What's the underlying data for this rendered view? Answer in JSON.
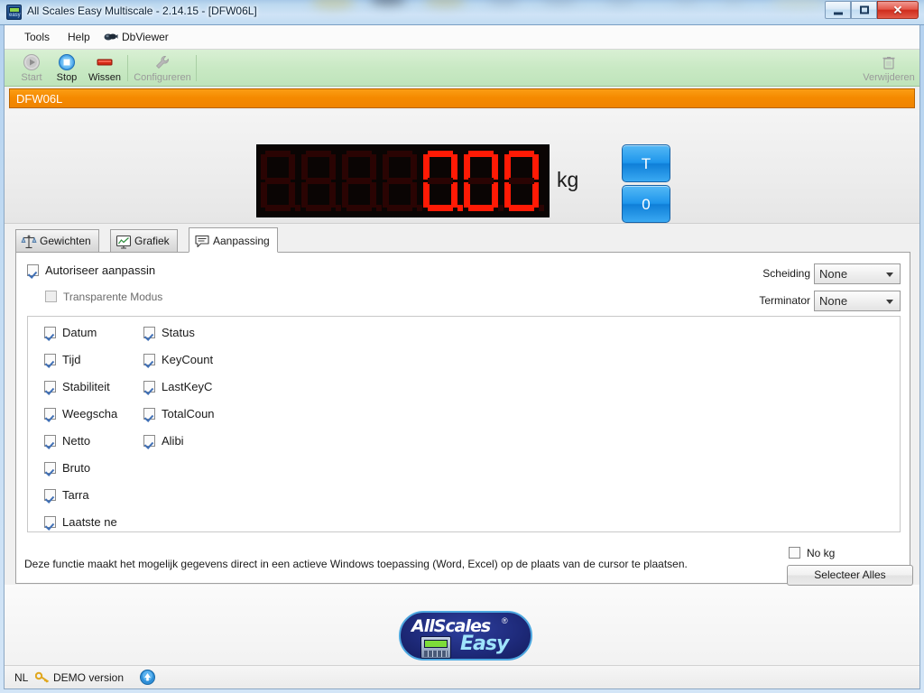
{
  "window": {
    "title": "All Scales Easy Multiscale - 2.14.15 - [DFW06L]",
    "app_icon": "allscales-easy-icon",
    "controls": {
      "minimize": "—",
      "maximize": "□",
      "close": "✕"
    }
  },
  "menubar": {
    "items": [
      {
        "label": "Tools",
        "icon": null
      },
      {
        "label": "Help",
        "icon": null
      },
      {
        "label": "DbViewer",
        "icon": "database-viewer-icon"
      }
    ]
  },
  "toolbar": {
    "buttons": [
      {
        "label": "Start",
        "icon": "play-icon",
        "enabled": false
      },
      {
        "label": "Stop",
        "icon": "stop-square-icon",
        "enabled": true
      },
      {
        "label": "Wissen",
        "icon": "eraser-icon",
        "enabled": true
      },
      {
        "label": "Configureren",
        "icon": "wrench-icon",
        "enabled": false
      }
    ],
    "delete_button": {
      "label": "Verwijderen",
      "icon": "trash-icon",
      "enabled": false
    }
  },
  "scale_header": {
    "name": "DFW06L",
    "background_color": "#f58a00",
    "text_color": "#ffffff"
  },
  "display": {
    "placeholder_digits": "8888888",
    "value": "0.00",
    "lit_color": "#ff1a05",
    "dim_color": "#2a0403",
    "background_color": "#0a0504",
    "unit": "kg",
    "buttons": [
      {
        "label": "T",
        "name": "tare-button"
      },
      {
        "label": "0",
        "name": "zero-button"
      }
    ]
  },
  "tabs": [
    {
      "label": "Gewichten",
      "icon": "balance-scale-icon",
      "active": false
    },
    {
      "label": "Grafiek",
      "icon": "line-chart-icon",
      "active": false
    },
    {
      "label": "Aanpassing",
      "icon": "speech-bubble-icon",
      "active": true
    }
  ],
  "panel": {
    "authorize": {
      "label": "Autoriseer aanpassin",
      "checked": true
    },
    "transparent_mode": {
      "label": "Transparente Modus",
      "checked": false,
      "enabled": false
    },
    "dropdowns": [
      {
        "label": "Scheiding",
        "value": "None"
      },
      {
        "label": "Terminator",
        "value": "None"
      }
    ],
    "fields_column_left": [
      {
        "label": "Datum",
        "checked": true
      },
      {
        "label": "Tijd",
        "checked": true
      },
      {
        "label": "Stabiliteit",
        "checked": true
      },
      {
        "label": "Weegscha",
        "checked": true
      },
      {
        "label": "Netto",
        "checked": true
      },
      {
        "label": "Bruto",
        "checked": true
      },
      {
        "label": "Tarra",
        "checked": true
      },
      {
        "label": "Laatste ne",
        "checked": true
      }
    ],
    "fields_column_right": [
      {
        "label": "Status",
        "checked": true
      },
      {
        "label": "KeyCount",
        "checked": true
      },
      {
        "label": "LastKeyC",
        "checked": true
      },
      {
        "label": "TotalCoun",
        "checked": true
      },
      {
        "label": "Alibi",
        "checked": true
      }
    ],
    "description": "Deze functie maakt het mogelijk gegevens direct in een actieve Windows toepassing (Word, Excel) op de plaats van de cursor te plaatsen.",
    "no_kg": {
      "label": "No kg",
      "checked": false
    },
    "select_all_button": "Selecteer Alles"
  },
  "logo": {
    "brand_top": "AllScales",
    "registered": "®",
    "brand_bottom": "Easy",
    "device_icon": "weighing-indicator-icon"
  },
  "statusbar": {
    "language": "NL",
    "key_icon": "key-icon",
    "license": "DEMO version",
    "update_icon": "update-arrow-icon"
  }
}
